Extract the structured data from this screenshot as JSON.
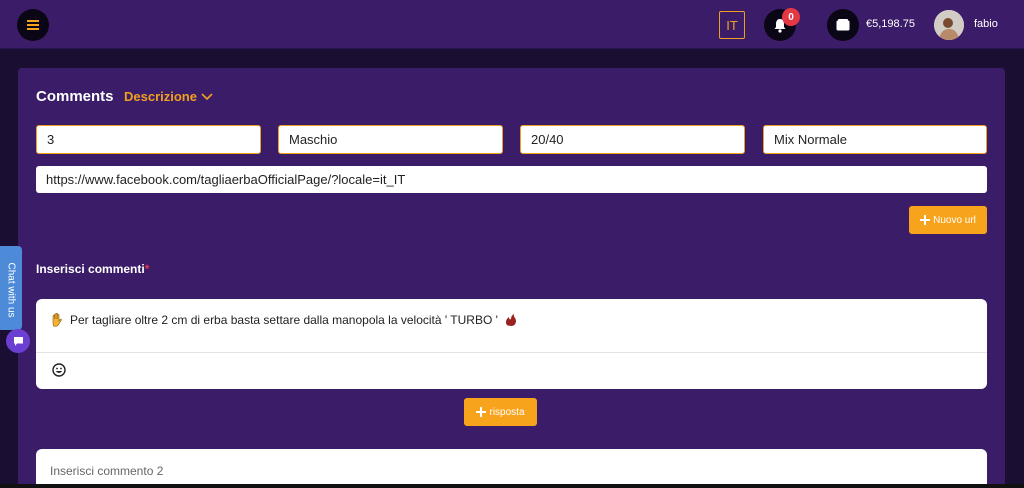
{
  "header": {
    "language": "IT",
    "notifications_count": "0",
    "balance": "€5,198.75",
    "username": "fabio"
  },
  "section": {
    "title": "Comments",
    "description_link": "Descrizione"
  },
  "fields": {
    "quantity": "3",
    "gender": "Maschio",
    "ratio": "20/40",
    "mix": "Mix Normale",
    "url": "https://www.facebook.com/tagliaerbaOfficialPage/?locale=it_IT"
  },
  "buttons": {
    "new_url": "Nuovo url",
    "reply": "risposta"
  },
  "comments": {
    "label": "Inserisci commenti",
    "required_mark": "*",
    "comment1_text": "Per tagliare oltre 2 cm di erba basta settare dalla manopola la velocità ' TURBO '",
    "comment2_placeholder": "Inserisci commento 2"
  },
  "chat": {
    "label": "Chat with us"
  },
  "colors": {
    "accent": "#f7a41c",
    "panel": "#3b1c68",
    "badge": "#e53845",
    "chat": "#4d8bd9"
  },
  "icons": [
    "hamburger-icon",
    "bell-icon",
    "wallet-icon",
    "chevron-down-icon",
    "plus-icon",
    "hand-emoji-icon",
    "smiley-icon",
    "chat-icon"
  ]
}
